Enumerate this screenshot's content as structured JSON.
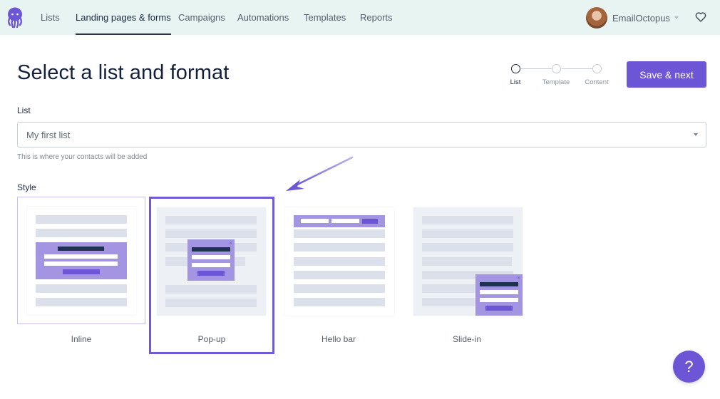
{
  "nav": {
    "items": [
      {
        "label": "Lists",
        "active": false
      },
      {
        "label": "Landing pages & forms",
        "active": true
      },
      {
        "label": "Campaigns",
        "active": false
      },
      {
        "label": "Automations",
        "active": false
      },
      {
        "label": "Templates",
        "active": false
      },
      {
        "label": "Reports",
        "active": false
      }
    ],
    "user_name": "EmailOctopus",
    "logo_icon": "octopus-logo-icon",
    "favorites_icon": "heart-icon"
  },
  "page": {
    "title": "Select a list and format",
    "save_label": "Save & next"
  },
  "stepper": {
    "steps": [
      {
        "label": "List",
        "current": true
      },
      {
        "label": "Template",
        "current": false
      },
      {
        "label": "Content",
        "current": false
      }
    ]
  },
  "list_field": {
    "label": "List",
    "value": "My first list",
    "hint": "This is where your contacts will be added"
  },
  "style": {
    "label": "Style",
    "selected": "Pop-up",
    "options": [
      {
        "label": "Inline"
      },
      {
        "label": "Pop-up"
      },
      {
        "label": "Hello bar"
      },
      {
        "label": "Slide-in"
      }
    ]
  },
  "help": {
    "label": "?"
  },
  "colors": {
    "accent": "#6d56d6",
    "nav_bg": "#e8f4f2",
    "text_dark": "#14213d",
    "form_purple": "#a495e3"
  }
}
